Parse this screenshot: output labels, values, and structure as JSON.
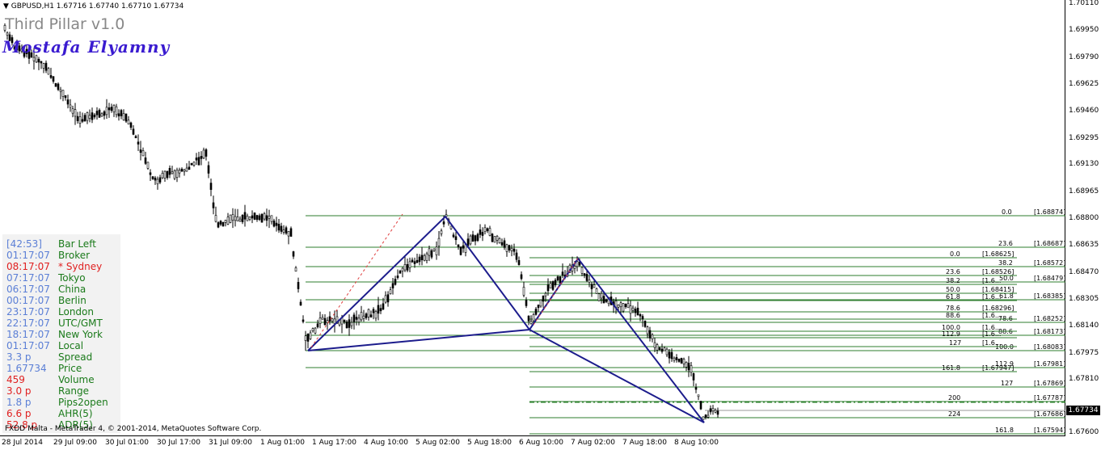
{
  "header": {
    "symbol_line": "▼ GBPUSD,H1  1.67716 1.67740 1.67710 1.67734",
    "indicator_title": "Third Pillar v1.0",
    "author": "Mostafa Elyamny"
  },
  "footer": {
    "copyright": "FXDD Malta - MetaTrader 4, © 2001-2014, MetaQuotes Software Corp."
  },
  "price_axis": {
    "labels": [
      "1.70110",
      "1.69950",
      "1.69790",
      "1.69625",
      "1.69460",
      "1.69295",
      "1.69130",
      "1.68965",
      "1.68800",
      "1.68635",
      "1.68470",
      "1.68305",
      "1.68140",
      "1.67975",
      "1.67810",
      "1.67600"
    ],
    "current_price": "1.67734"
  },
  "time_axis": {
    "labels": [
      "28 Jul 2014",
      "29 Jul 09:00",
      "30 Jul 01:00",
      "30 Jul 17:00",
      "31 Jul 09:00",
      "1 Aug 01:00",
      "1 Aug 17:00",
      "4 Aug 10:00",
      "5 Aug 02:00",
      "5 Aug 18:00",
      "6 Aug 10:00",
      "7 Aug 02:00",
      "7 Aug 18:00",
      "8 Aug 10:00"
    ]
  },
  "session_panel": [
    {
      "value": "[42:53]",
      "label": "Bar Left",
      "value_color": "#5b7fd6",
      "label_color": "#1a7a1a"
    },
    {
      "value": "01:17:07",
      "label": "Broker",
      "value_color": "#5b7fd6",
      "label_color": "#1a7a1a"
    },
    {
      "value": "08:17:07",
      "label": "* Sydney",
      "value_color": "#e02020",
      "label_color": "#e02020"
    },
    {
      "value": "07:17:07",
      "label": "Tokyo",
      "value_color": "#5b7fd6",
      "label_color": "#1a7a1a"
    },
    {
      "value": "06:17:07",
      "label": "China",
      "value_color": "#5b7fd6",
      "label_color": "#1a7a1a"
    },
    {
      "value": "00:17:07",
      "label": "Berlin",
      "value_color": "#5b7fd6",
      "label_color": "#1a7a1a"
    },
    {
      "value": "23:17:07",
      "label": "London",
      "value_color": "#5b7fd6",
      "label_color": "#1a7a1a"
    },
    {
      "value": "22:17:07",
      "label": "UTC/GMT",
      "value_color": "#5b7fd6",
      "label_color": "#1a7a1a"
    },
    {
      "value": "18:17:07",
      "label": "New York",
      "value_color": "#5b7fd6",
      "label_color": "#1a7a1a"
    },
    {
      "value": "01:17:07",
      "label": "Local",
      "value_color": "#5b7fd6",
      "label_color": "#1a7a1a"
    },
    {
      "value": "3.3 p",
      "label": "Spread",
      "value_color": "#5b7fd6",
      "label_color": "#1a7a1a"
    },
    {
      "value": "1.67734",
      "label": "Price",
      "value_color": "#5b7fd6",
      "label_color": "#1a7a1a"
    },
    {
      "value": "459",
      "label": "Volume",
      "value_color": "#e02020",
      "label_color": "#1a7a1a"
    },
    {
      "value": "3.0 p",
      "label": "Range",
      "value_color": "#e02020",
      "label_color": "#1a7a1a"
    },
    {
      "value": "1.8 p",
      "label": "Pips2open",
      "value_color": "#5b7fd6",
      "label_color": "#1a7a1a"
    },
    {
      "value": "6.6 p",
      "label": "AHR(5)",
      "value_color": "#e02020",
      "label_color": "#1a7a1a"
    },
    {
      "value": "52.8 p",
      "label": "ADR(5)",
      "value_color": "#e02020",
      "label_color": "#1a7a1a"
    }
  ],
  "fib_set_a": [
    {
      "level": "0.0",
      "price": "[1.68874]"
    },
    {
      "level": "23.6",
      "price": "[1.68687]"
    },
    {
      "level": "38.2",
      "price": "[1.68572]"
    },
    {
      "level": "50.0",
      "price": "[1.68479]"
    },
    {
      "level": "61.8",
      "price": "[1.68385]"
    },
    {
      "level": "78.6",
      "price": "[1.68252]"
    },
    {
      "level": "88.6",
      "price": "[1.68173]"
    },
    {
      "level": "100.0",
      "price": "[1.68083]"
    },
    {
      "level": "112.9",
      "price": "[1.67981]"
    },
    {
      "level": "127",
      "price": "[1.67869]"
    },
    {
      "level": "200",
      "price": "[1.67787]"
    },
    {
      "level": "224",
      "price": "[1.67686]"
    },
    {
      "level": "161.8",
      "price": "[1.67594]"
    }
  ],
  "fib_set_b": [
    {
      "level": "0.0",
      "price": "[1.68625]"
    },
    {
      "level": "23.6",
      "price": "[1.68526]"
    },
    {
      "level": "38.2",
      "price": "[1.6..."
    },
    {
      "level": "50.0",
      "price": "[1.68415]"
    },
    {
      "level": "61.8",
      "price": "[1.6..."
    },
    {
      "level": "78.6",
      "price": "[1.68296]"
    },
    {
      "level": "88.6",
      "price": "[1.6..."
    },
    {
      "level": "100.0",
      "price": "[1.6..."
    },
    {
      "level": "112.9",
      "price": "[1.6..."
    },
    {
      "level": "127",
      "price": "[1.6..."
    },
    {
      "level": "161.8",
      "price": "[1.67947]"
    }
  ],
  "colors": {
    "fib_line": "#2e7d2e",
    "pattern_line": "#1c1c8c",
    "trend_dash": "#e04040",
    "candle": "#000000"
  }
}
